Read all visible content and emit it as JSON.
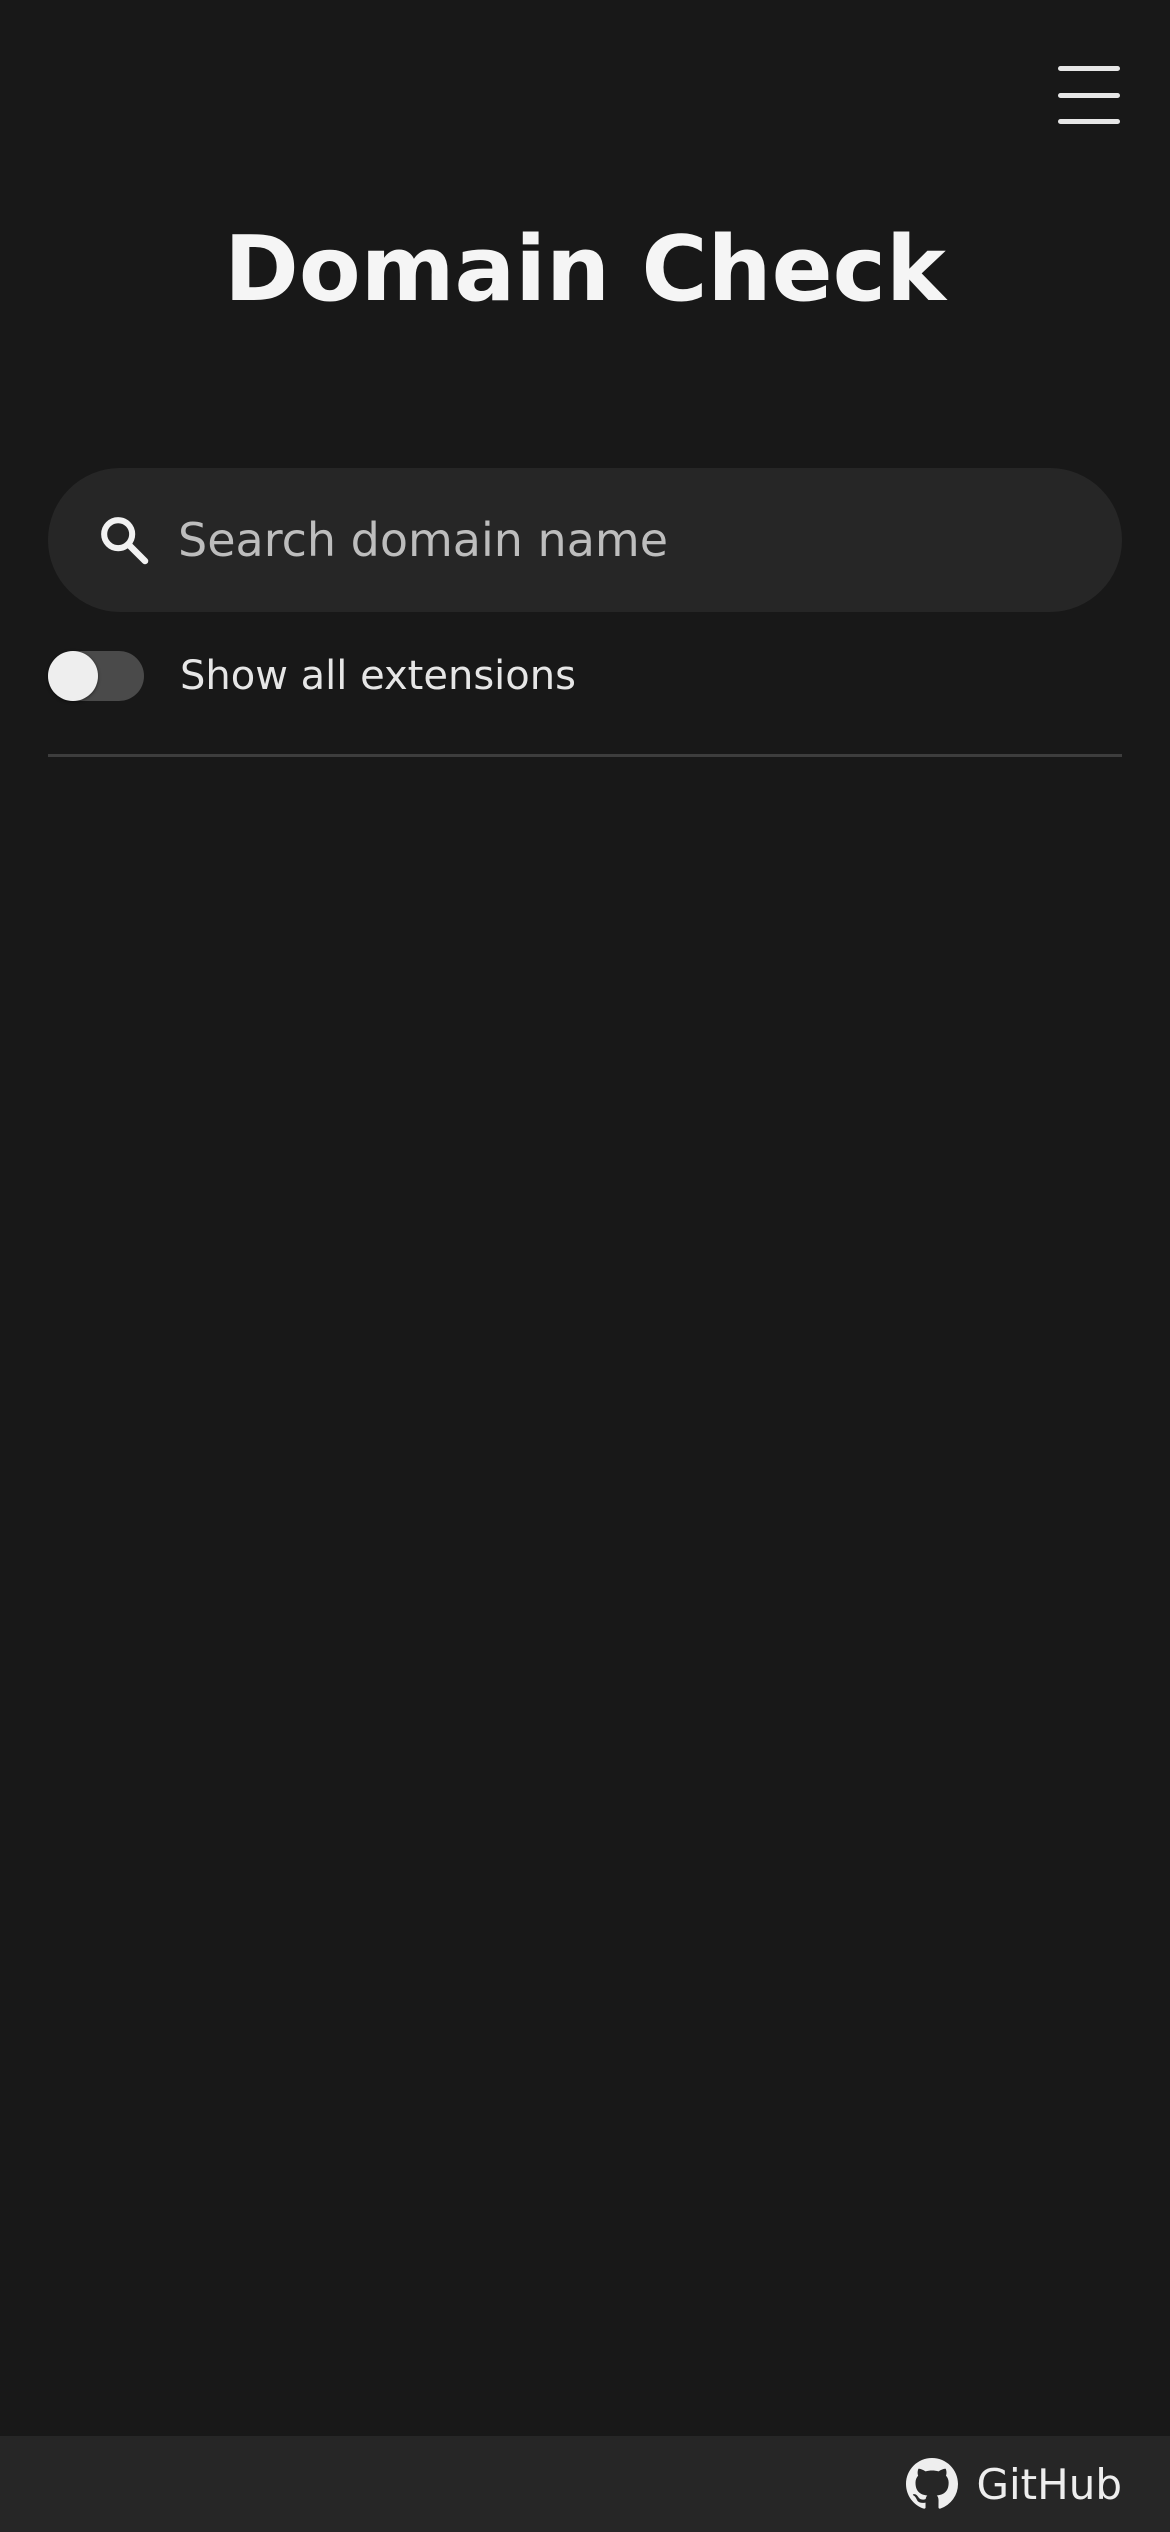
{
  "header": {
    "title": "Domain Check",
    "menu_icon": "hamburger-menu-icon"
  },
  "search": {
    "placeholder": "Search domain name",
    "value": "",
    "icon": "search-icon"
  },
  "options": {
    "show_all_extensions_label": "Show all extensions",
    "show_all_extensions_enabled": false
  },
  "footer": {
    "github_label": "GitHub",
    "github_icon": "github-icon"
  },
  "colors": {
    "background": "#181818",
    "surface": "#262626",
    "text": "#f2f2f2",
    "toggle_track": "#4a4a4a",
    "divider": "#3d3d3d"
  }
}
